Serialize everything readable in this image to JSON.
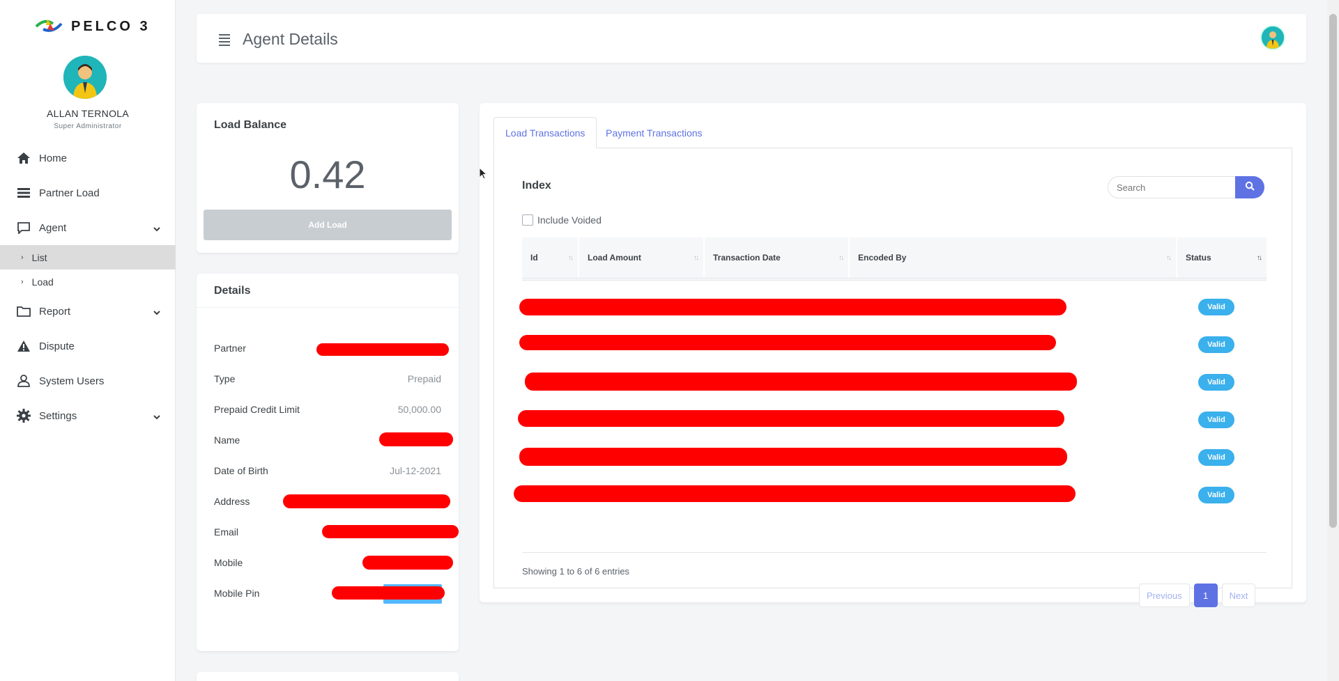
{
  "brand": {
    "name": "PELCO 3"
  },
  "user": {
    "name": "ALLAN TERNOLA",
    "role": "Super Administrator"
  },
  "sidebar": {
    "items": [
      {
        "label": "Home",
        "icon": "home-icon"
      },
      {
        "label": "Partner Load",
        "icon": "list-icon"
      },
      {
        "label": "Agent",
        "icon": "chat-icon",
        "expanded": true
      },
      {
        "label": "Report",
        "icon": "folder-icon"
      },
      {
        "label": "Dispute",
        "icon": "warning-icon"
      },
      {
        "label": "System Users",
        "icon": "user-icon"
      },
      {
        "label": "Settings",
        "icon": "gear-icon"
      }
    ],
    "agent_sub": [
      {
        "label": "List",
        "active": true
      },
      {
        "label": "Load",
        "active": false
      }
    ]
  },
  "header": {
    "title": "Agent Details"
  },
  "balance": {
    "title": "Load Balance",
    "value": "0.42",
    "add_label": "Add Load"
  },
  "details": {
    "title": "Details",
    "rows": [
      {
        "label": "Partner",
        "value": ""
      },
      {
        "label": "Type",
        "value": "Prepaid"
      },
      {
        "label": "Prepaid Credit Limit",
        "value": "50,000.00"
      },
      {
        "label": "Name",
        "value": ""
      },
      {
        "label": "Date of Birth",
        "value": "Jul-12-2021"
      },
      {
        "label": "Address",
        "value": ""
      },
      {
        "label": "Email",
        "value": ""
      },
      {
        "label": "Mobile",
        "value": ""
      },
      {
        "label": "Mobile Pin",
        "value": ""
      }
    ]
  },
  "transactions": {
    "tabs": [
      {
        "label": "Load Transactions",
        "active": true
      },
      {
        "label": "Payment Transactions",
        "active": false
      }
    ],
    "index_title": "Index",
    "search_placeholder": "Search",
    "include_voided": "Include Voided",
    "columns": [
      "Id",
      "Load Amount",
      "Transaction Date",
      "Encoded By",
      "Status"
    ],
    "rows": [
      {
        "status": "Valid"
      },
      {
        "status": "Valid"
      },
      {
        "status": "Valid"
      },
      {
        "status": "Valid"
      },
      {
        "status": "Valid"
      },
      {
        "status": "Valid"
      }
    ],
    "entries_text": "Showing 1 to 6 of 6 entries",
    "pager": {
      "previous": "Previous",
      "current": "1",
      "next": "Next"
    }
  },
  "colors": {
    "accent": "#5e72e4",
    "badge": "#3ab0ec",
    "redaction": "#ff0000"
  }
}
